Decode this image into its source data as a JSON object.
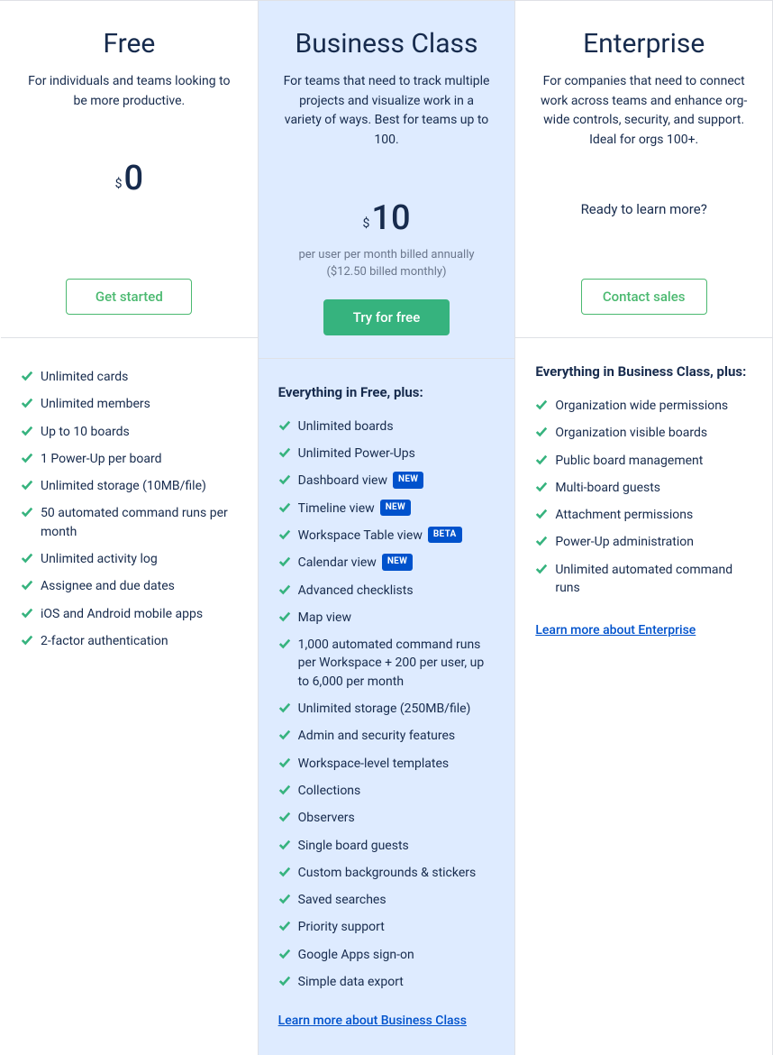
{
  "plans": [
    {
      "key": "free",
      "title": "Free",
      "description": "For individuals and teams looking to be more productive.",
      "price": "0",
      "price_sub": "",
      "cta_label": "Get started",
      "cta_style": "outline",
      "features_heading": "",
      "features": [
        {
          "label": "Unlimited cards"
        },
        {
          "label": "Unlimited members"
        },
        {
          "label": "Up to 10 boards"
        },
        {
          "label": "1 Power-Up per board"
        },
        {
          "label": "Unlimited storage (10MB/file)"
        },
        {
          "label": "50 automated command runs per month"
        },
        {
          "label": "Unlimited activity log"
        },
        {
          "label": "Assignee and due dates"
        },
        {
          "label": "iOS and Android mobile apps"
        },
        {
          "label": "2-factor authentication"
        }
      ],
      "learn_more": ""
    },
    {
      "key": "business-class",
      "title": "Business Class",
      "description": "For teams that need to track multiple projects and visualize work in a variety of ways. Best for teams up to 100.",
      "price": "10",
      "price_sub": "per user per month billed annually ($12.50 billed monthly)",
      "cta_label": "Try for free",
      "cta_style": "solid",
      "features_heading": "Everything in Free, plus:",
      "features": [
        {
          "label": "Unlimited boards"
        },
        {
          "label": "Unlimited Power-Ups"
        },
        {
          "label": "Dashboard view",
          "badge": "NEW"
        },
        {
          "label": "Timeline view",
          "badge": "NEW"
        },
        {
          "label": "Workspace Table view",
          "badge": "BETA"
        },
        {
          "label": "Calendar view",
          "badge": "NEW"
        },
        {
          "label": "Advanced checklists"
        },
        {
          "label": "Map view"
        },
        {
          "label": "1,000 automated command runs per Workspace + 200 per user, up to 6,000 per month"
        },
        {
          "label": "Unlimited storage (250MB/file)"
        },
        {
          "label": "Admin and security features"
        },
        {
          "label": "Workspace-level templates"
        },
        {
          "label": "Collections"
        },
        {
          "label": "Observers"
        },
        {
          "label": "Single board guests"
        },
        {
          "label": "Custom backgrounds & stickers"
        },
        {
          "label": "Saved searches"
        },
        {
          "label": "Priority support"
        },
        {
          "label": "Google Apps sign-on"
        },
        {
          "label": "Simple data export"
        }
      ],
      "learn_more": "Learn more about Business Class"
    },
    {
      "key": "enterprise",
      "title": "Enterprise",
      "description": "For companies that need to connect work across teams and enhance org-wide controls, security, and support. Ideal for orgs 100+.",
      "ready_text": "Ready to learn more?",
      "cta_label": "Contact sales",
      "cta_style": "outline",
      "features_heading": "Everything in Business Class, plus:",
      "features": [
        {
          "label": "Organization wide permissions"
        },
        {
          "label": "Organization visible boards"
        },
        {
          "label": "Public board management"
        },
        {
          "label": "Multi-board guests"
        },
        {
          "label": "Attachment permissions"
        },
        {
          "label": "Power-Up administration"
        },
        {
          "label": "Unlimited automated command runs"
        }
      ],
      "learn_more": "Learn more about Enterprise"
    }
  ]
}
